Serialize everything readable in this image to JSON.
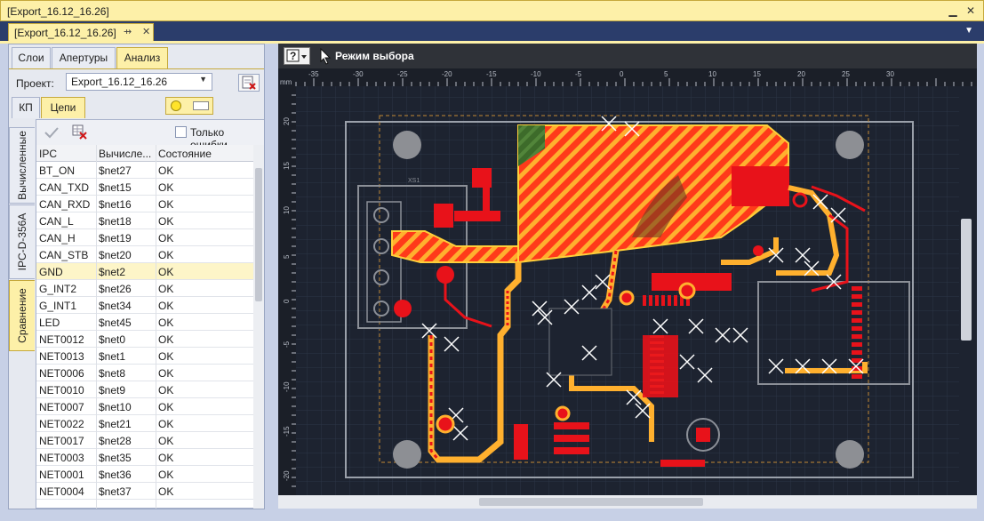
{
  "window": {
    "title": "[Export_16.12_16.26]",
    "minimize": "▁",
    "close": "✕"
  },
  "doc_tab": {
    "label": "[Export_16.12_16.26]",
    "pin": "⇸",
    "close": "✕",
    "menu": "▼"
  },
  "top_tabs": [
    "Слои",
    "Апертуры",
    "Анализ"
  ],
  "project": {
    "label": "Проект:",
    "value": "Export_16.12_16.26"
  },
  "sub_tabs": [
    "КП",
    "Цепи"
  ],
  "vertical_tabs": [
    "Вычисленные",
    "IPC-D-356A",
    "Сравнение"
  ],
  "filter": {
    "label": "Только ошибки"
  },
  "table": {
    "headers": [
      "IPC",
      "Вычисле...",
      "Состояние"
    ],
    "selected_row": 6,
    "rows": [
      [
        "BT_ON",
        "$net27",
        "OK"
      ],
      [
        "CAN_TXD",
        "$net15",
        "OK"
      ],
      [
        "CAN_RXD",
        "$net16",
        "OK"
      ],
      [
        "CAN_L",
        "$net18",
        "OK"
      ],
      [
        "CAN_H",
        "$net19",
        "OK"
      ],
      [
        "CAN_STB",
        "$net20",
        "OK"
      ],
      [
        "GND",
        "$net2",
        "OK"
      ],
      [
        "G_INT2",
        "$net26",
        "OK"
      ],
      [
        "G_INT1",
        "$net34",
        "OK"
      ],
      [
        "LED",
        "$net45",
        "OK"
      ],
      [
        "NET0012",
        "$net0",
        "OK"
      ],
      [
        "NET0013",
        "$net1",
        "OK"
      ],
      [
        "NET0006",
        "$net8",
        "OK"
      ],
      [
        "NET0010",
        "$net9",
        "OK"
      ],
      [
        "NET0007",
        "$net10",
        "OK"
      ],
      [
        "NET0022",
        "$net21",
        "OK"
      ],
      [
        "NET0017",
        "$net28",
        "OK"
      ],
      [
        "NET0003",
        "$net35",
        "OK"
      ],
      [
        "NET0001",
        "$net36",
        "OK"
      ],
      [
        "NET0004",
        "$net37",
        "OK"
      ]
    ]
  },
  "canvas": {
    "mode_label": "Режим выбора",
    "unit": "mm",
    "x_ticks": [
      "-35",
      "-30",
      "-25",
      "-20",
      "-15",
      "-10",
      "-5",
      "0",
      "5",
      "10",
      "15",
      "20",
      "25",
      "30"
    ],
    "y_ticks": [
      "20",
      "15",
      "10",
      "5",
      "0",
      "-5",
      "-10",
      "-15",
      "-20"
    ],
    "silk_label": "XS1"
  },
  "colors": {
    "accent": "#fdf0a8",
    "copper": "#e8121a",
    "highlight": "#ffb02e",
    "board": "#1d2330",
    "outline": "#9aa0aa"
  }
}
